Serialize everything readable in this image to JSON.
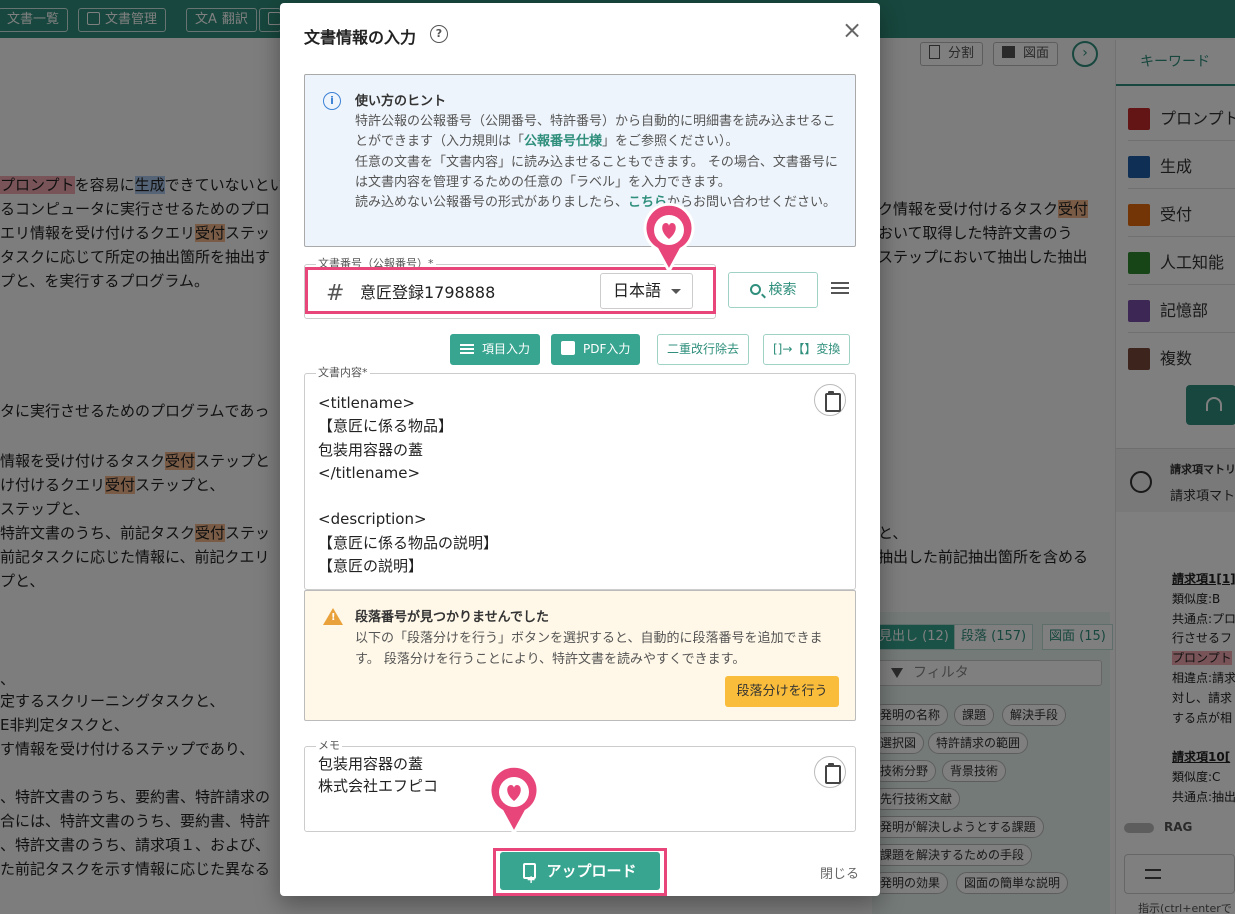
{
  "toolbar": {
    "doc_list": "文書一覧",
    "doc_manage": "文書管理",
    "translate": "翻訳"
  },
  "view_buttons": {
    "split": "分割",
    "figure": "図面"
  },
  "background_doc": {
    "line1_a": "プロンプト",
    "line1_b": "を容易に",
    "line1_c": "生成",
    "line1_d": "できていないとい",
    "line2": "るコンピュータに実行させるためのプロ",
    "line3_a": "エリ情報を受け付けるクエリ",
    "line3_b": "受付",
    "line3_c": "ステッ",
    "line4": "タスクに応じて所定の抽出箇所を抽出す",
    "line5": "プと、を実行するプログラム。",
    "r1_a": "ク情報を受け付けるタスク",
    "r1_b": "受付",
    "r2": "おいて取得した特許文書のう",
    "r3": "ステップにおいて抽出した抽出",
    "line6": "タに実行させるためのプログラムであっ",
    "line7_a": "情報を受け付けるタスク",
    "line7_b": "受付",
    "line7_c": "ステップと",
    "line8_a": "け付けるクエリ",
    "line8_b": "受付",
    "line8_c": "ステップと、",
    "line9": "ステップと、",
    "line10_a": "特許文書のうち、前記タスク",
    "line10_b": "受付",
    "line10_c": "ステッ",
    "line11": "前記タスクに応じた情報に、前記クエリ",
    "line12": "プと、",
    "r4": "と、",
    "r5": "抽出した前記抽出箇所を含める",
    "line13": "、",
    "line14": "定するスクリーニングタスクと、",
    "line15": "E非判定タスクと、",
    "line16": "す情報を受け付けるステップであり、",
    "line17": "、特許文書のうち、要約書、特許請求の",
    "line18": "合には、特許文書のうち、要約書、特許",
    "line19": "、特許文書のうち、請求項１、および、",
    "line20": "た前記タスクを示す情報に応じた異なる"
  },
  "right_panel": {
    "tab": "キーワード",
    "keywords": [
      {
        "label": "プロンプト",
        "color": "#c62828"
      },
      {
        "label": "生成",
        "color": "#1e5fa8"
      },
      {
        "label": "受付",
        "color": "#e66b0a"
      },
      {
        "label": "人工知能",
        "color": "#2e8b2e"
      },
      {
        "label": "記憶部",
        "color": "#7b4fa8"
      },
      {
        "label": "複数",
        "color": "#7a4a3a"
      }
    ],
    "card_title": "請求項マトリ",
    "card_sub": "請求項マトリ",
    "claims": {
      "c1": "請求項1[1]",
      "c1_sim": "類似度:B",
      "c1_common": "共通点:プロ",
      "c1_l3": "行させるフ",
      "c1_l4": "プロンプト",
      "c1_diff": "相違点:請求",
      "c1_l6": "対し、請求",
      "c1_l7": "する点が相",
      "c10": "請求項10[",
      "c10_sim": "類似度:C",
      "c10_common": "共通点:抽出"
    },
    "rag": "RAG",
    "hint": "指示(ctrl+enterで"
  },
  "mid_panel": {
    "tabs": [
      "見出し (12)",
      "段落 (157)",
      "図面 (15)"
    ],
    "filter_placeholder": "フィルタ",
    "chips": [
      "発明の名称",
      "課題",
      "解決手段",
      "選択図",
      "特許請求の範囲",
      "技術分野",
      "背景技術",
      "先行技術文献",
      "発明が解決しようとする課題",
      "課題を解決するための手段",
      "発明の効果",
      "図面の簡単な説明"
    ]
  },
  "dialog": {
    "title": "文書情報の入力",
    "hint_title": "使い方のヒント",
    "hint_p1_a": "特許公報の公報番号（公開番号、特許番号）から自動的に明細書を読み込ませることができます（入力規則は「",
    "hint_p1_link": "公報番号仕様",
    "hint_p1_b": "」をご参照ください）。",
    "hint_p2": "任意の文書を「文書内容」に読み込ませることもできます。 その場合、文書番号には文書内容を管理するための任意の「ラベル」を入力できます。",
    "hint_p3_a": "読み込めない公報番号の形式がありましたら、",
    "hint_p3_link": "こちら",
    "hint_p3_b": "からお問い合わせください。",
    "docnum_label": "文書番号（公報番号）*",
    "docnum_value": "意匠登録1798888",
    "language": "日本語",
    "search": "検索",
    "btn_item_input": "項目入力",
    "btn_pdf_input": "PDF入力",
    "btn_remove_double": "二重改行除去",
    "btn_convert": "[]→【】変換",
    "content_label": "文書内容*",
    "content_lines": [
      "<titlename>",
      "【意匠に係る物品】",
      "包装用容器の蓋",
      "</titlename>",
      "",
      "<description>",
      "【意匠に係る物品の説明】",
      "【意匠の説明】"
    ],
    "warn_title": "段落番号が見つかりませんでした",
    "warn_body": "以下の「段落分けを行う」ボタンを選択すると、自動的に段落番号を追加できます。 段落分けを行うことにより、特許文書を読みやすくできます。",
    "para_button": "段落分けを行う",
    "memo_label": "メモ",
    "memo_lines": [
      "包装用容器の蓋",
      "株式会社エフピコ"
    ],
    "upload": "アップロード",
    "close": "閉じる"
  },
  "colors": {
    "accent": "#37a590",
    "highlight_frame": "#e8457a",
    "warning_button": "#f9bd3b"
  }
}
